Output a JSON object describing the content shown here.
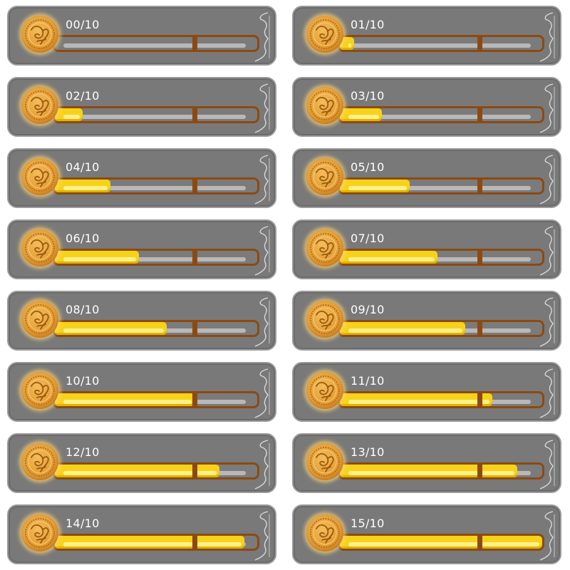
{
  "meters": [
    {
      "label": "00/10",
      "progress": 0
    },
    {
      "label": "01/10",
      "progress": 1
    },
    {
      "label": "02/10",
      "progress": 2
    },
    {
      "label": "03/10",
      "progress": 3
    },
    {
      "label": "04/10",
      "progress": 4
    },
    {
      "label": "05/10",
      "progress": 5
    },
    {
      "label": "06/10",
      "progress": 6
    },
    {
      "label": "07/10",
      "progress": 7
    },
    {
      "label": "08/10",
      "progress": 8
    },
    {
      "label": "09/10",
      "progress": 9
    },
    {
      "label": "10/10",
      "progress": 10
    },
    {
      "label": "11/10",
      "progress": 11
    },
    {
      "label": "12/10",
      "progress": 12
    },
    {
      "label": "13/10",
      "progress": 13
    },
    {
      "label": "14/10",
      "progress": 14
    },
    {
      "label": "15/10",
      "progress": 15
    }
  ],
  "capacity": 10,
  "max_display": 15,
  "colors": {
    "panel": "#797979",
    "track_border": "#8c4a12",
    "fill": "#f7d21b",
    "empty_bar": "#b8b8b8",
    "coin": "#e39d35",
    "text": "#ffffff"
  },
  "icons": {
    "coin": "gold-coin-icon",
    "ornament": "corner-flourish-ornament"
  }
}
